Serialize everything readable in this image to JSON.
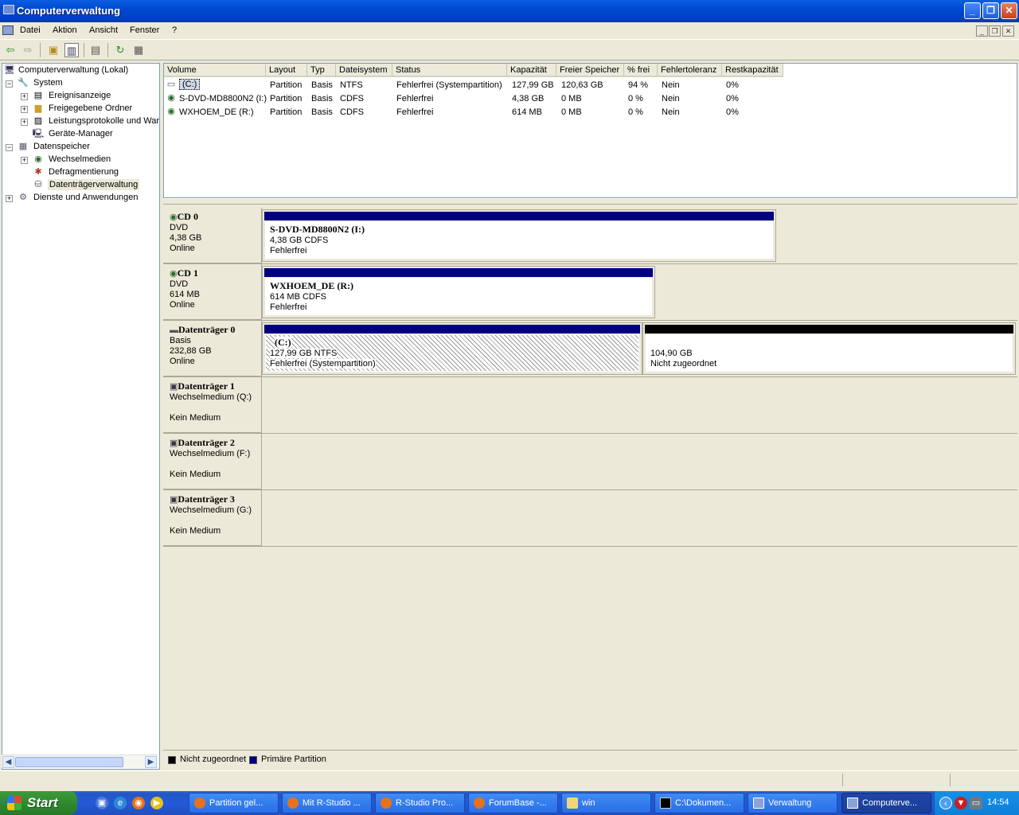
{
  "window": {
    "title": "Computerverwaltung",
    "minimize": "_",
    "maximize": "❐",
    "close": "✕"
  },
  "menu": {
    "items": [
      "Datei",
      "Aktion",
      "Ansicht",
      "Fenster",
      "?"
    ],
    "mdi": [
      "_",
      "❐",
      "✕"
    ]
  },
  "toolbar": {
    "icons": [
      "back-icon",
      "forward-icon",
      "up-folder-icon",
      "show-hide-tree-icon",
      "properties-icon",
      "refresh-icon",
      "export-list-icon"
    ]
  },
  "tree": {
    "root": "Computerverwaltung (Lokal)",
    "system": "System",
    "eventviewer": "Ereignisanzeige",
    "shared": "Freigegebene Ordner",
    "perf": "Leistungsprotokolle und Warnungen",
    "devmgr": "Geräte-Manager",
    "storage": "Datenspeicher",
    "removable": "Wechselmedien",
    "defrag": "Defragmentierung",
    "diskmgmt": "Datenträgerverwaltung",
    "services": "Dienste und Anwendungen"
  },
  "volumes": {
    "headers": [
      "Volume",
      "Layout",
      "Typ",
      "Dateisystem",
      "Status",
      "Kapazität",
      "Freier Speicher",
      "% frei",
      "Fehlertoleranz",
      "Restkapazität"
    ],
    "rows": [
      [
        "(C:)",
        "Partition",
        "Basis",
        "NTFS",
        "Fehlerfrei (Systempartition)",
        "127,99 GB",
        "120,63 GB",
        "94 %",
        "Nein",
        "0%"
      ],
      [
        "S-DVD-MD8800N2 (I:)",
        "Partition",
        "Basis",
        "CDFS",
        "Fehlerfrei",
        "4,38 GB",
        "0 MB",
        "0 %",
        "Nein",
        "0%"
      ],
      [
        "WXHOEM_DE (R:)",
        "Partition",
        "Basis",
        "CDFS",
        "Fehlerfrei",
        "614 MB",
        "0 MB",
        "0 %",
        "Nein",
        "0%"
      ]
    ]
  },
  "disks": [
    {
      "name": "CD 0",
      "type": "DVD",
      "size": "4,38 GB",
      "state": "Online",
      "partitions": [
        {
          "title": "S-DVD-MD8800N2  (I:)",
          "detail": "4,38 GB CDFS",
          "status": "Fehlerfrei"
        }
      ]
    },
    {
      "name": "CD 1",
      "type": "DVD",
      "size": "614 MB",
      "state": "Online",
      "partitions": [
        {
          "title": "WXHOEM_DE  (R:)",
          "detail": "614 MB CDFS",
          "status": "Fehlerfrei"
        }
      ]
    },
    {
      "name": "Datenträger 0",
      "type": "Basis",
      "size": "232,88 GB",
      "state": "Online",
      "partitions": [
        {
          "title": "(C:)",
          "detail": "127,99 GB NTFS",
          "status": "Fehlerfrei (Systempartition)"
        },
        {
          "title": "",
          "detail": "104,90 GB",
          "status": "Nicht zugeordnet"
        }
      ]
    },
    {
      "name": "Datenträger 1",
      "type": "Wechselmedium (Q:)",
      "state": "Kein Medium"
    },
    {
      "name": "Datenträger 2",
      "type": "Wechselmedium (F:)",
      "state": "Kein Medium"
    },
    {
      "name": "Datenträger 3",
      "type": "Wechselmedium (G:)",
      "state": "Kein Medium"
    }
  ],
  "legend": {
    "unallocated": "Nicht zugeordnet",
    "primary": "Primäre Partition",
    "unallocated_color": "#000000",
    "primary_color": "#000080"
  },
  "taskbar": {
    "start": "Start",
    "buttons": [
      "Partition gel...",
      "Mit R-Studio ...",
      "R-Studio Pro...",
      "ForumBase -...",
      "win",
      "C:\\Dokumen...",
      "Verwaltung",
      "Computerve..."
    ],
    "clock": "14:54"
  }
}
